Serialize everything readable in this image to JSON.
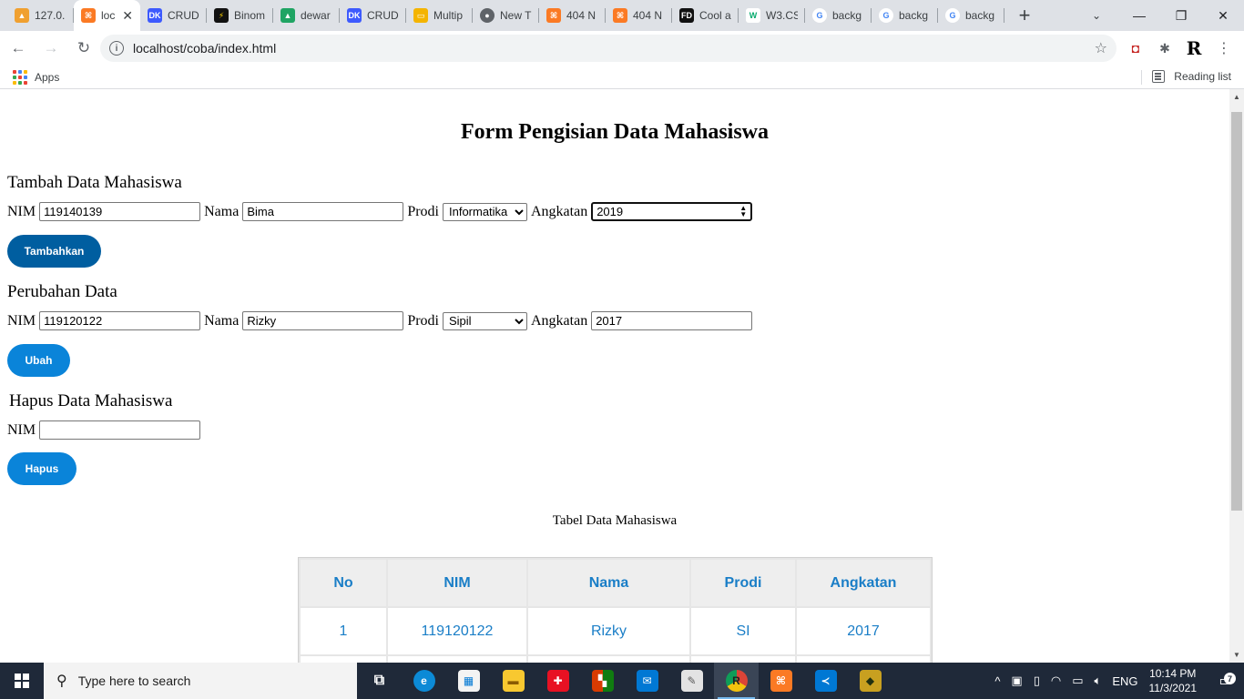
{
  "browser": {
    "tabs": [
      {
        "title": "127.0.",
        "favicon": "pma-icon",
        "color": "#f0a030",
        "active": false
      },
      {
        "title": "loc",
        "favicon": "xampp-icon",
        "color": "#fb7a24",
        "active": true
      },
      {
        "title": "CRUD",
        "favicon": "dk-icon",
        "color": "#3d5afe",
        "active": false
      },
      {
        "title": "Binom",
        "favicon": "lightning-icon",
        "color": "#111111",
        "active": false
      },
      {
        "title": "dewar",
        "favicon": "drive-icon",
        "color": "#1fa463",
        "active": false
      },
      {
        "title": "CRUD",
        "favicon": "dk-icon",
        "color": "#3d5afe",
        "active": false
      },
      {
        "title": "Multip",
        "favicon": "slides-icon",
        "color": "#f4b400",
        "active": false
      },
      {
        "title": "New T",
        "favicon": "chrome-icon",
        "color": "#5f6368",
        "active": false
      },
      {
        "title": "404 N",
        "favicon": "xampp-icon",
        "color": "#fb7a24",
        "active": false
      },
      {
        "title": "404 N",
        "favicon": "xampp-icon",
        "color": "#fb7a24",
        "active": false
      },
      {
        "title": "Cool a",
        "favicon": "fd-icon",
        "color": "#111111",
        "active": false
      },
      {
        "title": "W3.CS",
        "favicon": "w3-icon",
        "color": "#04aa6d",
        "active": false
      },
      {
        "title": "backg",
        "favicon": "google-icon",
        "color": "#4285f4",
        "active": false
      },
      {
        "title": "backg",
        "favicon": "google-icon",
        "color": "#4285f4",
        "active": false
      },
      {
        "title": "backg",
        "favicon": "google-icon",
        "color": "#4285f4",
        "active": false
      }
    ],
    "url": "localhost/coba/index.html",
    "bookmarks": {
      "apps_label": "Apps",
      "reading_list_label": "Reading list"
    }
  },
  "page": {
    "title": "Form Pengisian Data Mahasiswa",
    "add_section": {
      "heading": "Tambah Data Mahasiswa",
      "nim_label": "NIM",
      "nim_value": "119140139",
      "nama_label": "Nama",
      "nama_value": "Bima",
      "prodi_label": "Prodi",
      "prodi_value": "Informatika",
      "angkatan_label": "Angkatan",
      "angkatan_value": "2019",
      "button": "Tambahkan"
    },
    "edit_section": {
      "heading": "Perubahan Data",
      "nim_label": "NIM",
      "nim_value": "119120122",
      "nama_label": "Nama",
      "nama_value": "Rizky",
      "prodi_label": "Prodi",
      "prodi_value": "Sipil",
      "angkatan_label": "Angkatan",
      "angkatan_value": "2017",
      "button": "Ubah"
    },
    "delete_section": {
      "heading": "Hapus Data Mahasiswa",
      "nim_label": "NIM",
      "nim_value": "",
      "button": "Hapus"
    },
    "table": {
      "caption": "Tabel Data Mahasiswa",
      "headers": [
        "No",
        "NIM",
        "Nama",
        "Prodi",
        "Angkatan"
      ],
      "rows": [
        [
          "1",
          "119120122",
          "Rizky",
          "SI",
          "2017"
        ],
        [
          "",
          "",
          "",
          "",
          ""
        ]
      ]
    }
  },
  "taskbar": {
    "search_placeholder": "Type here to search",
    "language": "ENG",
    "time": "10:14 PM",
    "date": "11/3/2021",
    "notification_count": "7"
  }
}
